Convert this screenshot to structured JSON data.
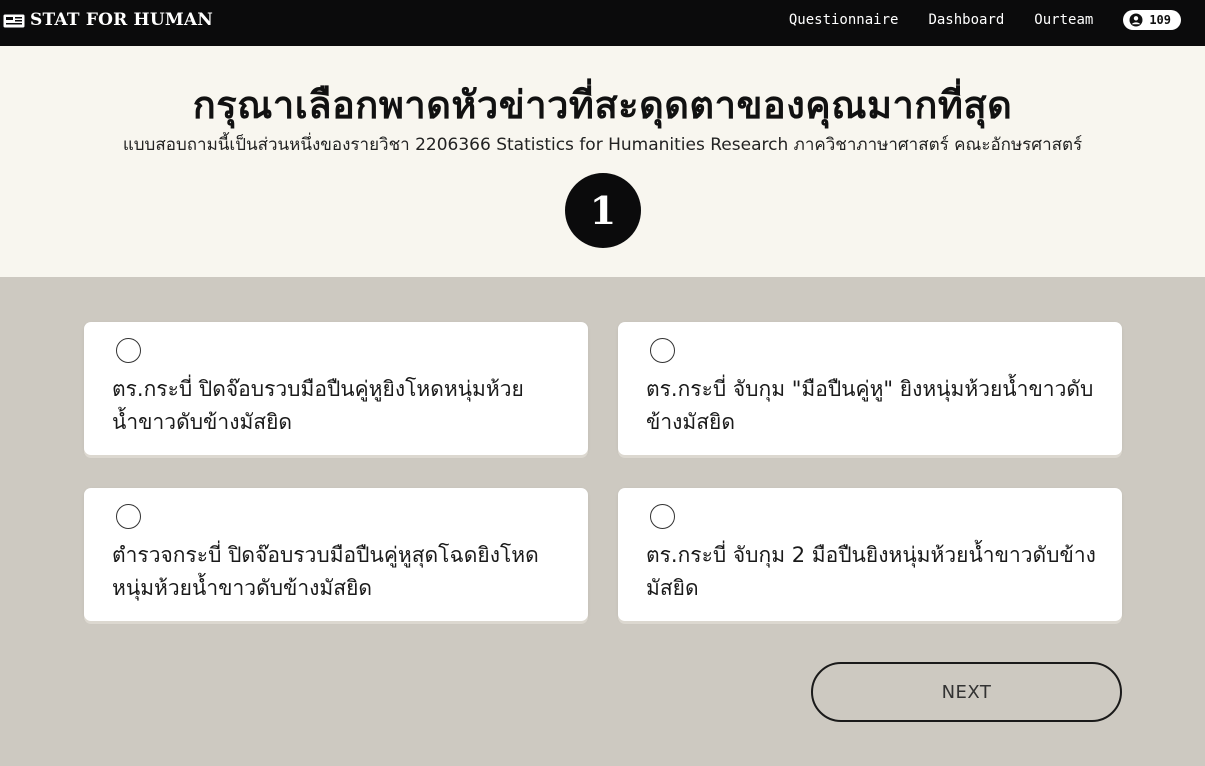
{
  "navbar": {
    "brand": "STAT FOR HUMAN",
    "brand_icon": "newspaper-icon",
    "links": [
      "Questionnaire",
      "Dashboard",
      "Ourteam"
    ],
    "counter": "109",
    "counter_icon": "user-circle-icon"
  },
  "header": {
    "title": "กรุณาเลือกพาดหัวข่าวที่สะดุดตาของคุณมากที่สุด",
    "subtitle": "แบบสอบถามนี้เป็นส่วนหนึ่งของรายวิชา 2206366 Statistics for Humanities Research ภาควิชาภาษาศาสตร์ คณะอักษรศาสตร์",
    "question_number": "1"
  },
  "options": [
    "ตร.กระบี่ ปิดจ๊อบรวบมือปืนคู่หูยิงโหดหนุ่มห้วยน้ำขาวดับข้างมัสยิด",
    "ตร.กระบี่ จับกุม \"มือปืนคู่หู\" ยิงหนุ่มห้วยน้ำขาวดับข้างมัสยิด",
    "ตำรวจกระบี่ ปิดจ๊อบรวบมือปืนคู่หูสุดโฉดยิงโหดหนุ่มห้วยน้ำขาวดับข้างมัสยิด",
    "ตร.กระบี่ จับกุม 2 มือปืนยิงหนุ่มห้วยน้ำขาวดับข้างมัสยิด"
  ],
  "next_label": "NEXT",
  "colors": {
    "navbar_bg": "#0b0b0c",
    "header_bg": "#f8f6ef",
    "body_bg": "#cdc9c1",
    "card_bg": "#ffffff"
  }
}
